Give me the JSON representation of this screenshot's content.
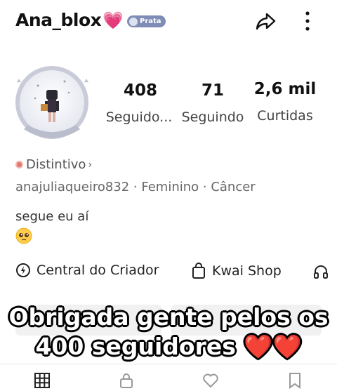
{
  "header": {
    "username": "Ana_blox",
    "heart_emoji": "💗",
    "badge_label": "Prata"
  },
  "stats": [
    {
      "value": "408",
      "label": "Seguido..."
    },
    {
      "value": "71",
      "label": "Seguindo"
    },
    {
      "value": "2,6 mil",
      "label": "Curtidas"
    }
  ],
  "profile": {
    "distintivo": "Distintivo",
    "distintivo_chevron": "›",
    "meta": "anajuliaqueiro832 · Feminino · Câncer",
    "bio": "segue eu aí"
  },
  "tools": {
    "creator_center": "Central do Criador",
    "kwai_shop": "Kwai Shop"
  },
  "caption": {
    "line1": "Obrigada gente pelos os",
    "line2": "400 seguidores ❤️❤️"
  },
  "colors": {
    "badge": "#7f8cb5",
    "heart": "#e84b8a",
    "accent_red": "#e2786e"
  },
  "icons": [
    "heart-icon",
    "share-icon",
    "more-icon",
    "pleading-emoji-icon",
    "creator-center-icon",
    "shop-bag-icon",
    "headphones-icon",
    "grid-tab-icon",
    "lock-tab-icon",
    "like-tab-icon",
    "bookmark-tab-icon"
  ]
}
